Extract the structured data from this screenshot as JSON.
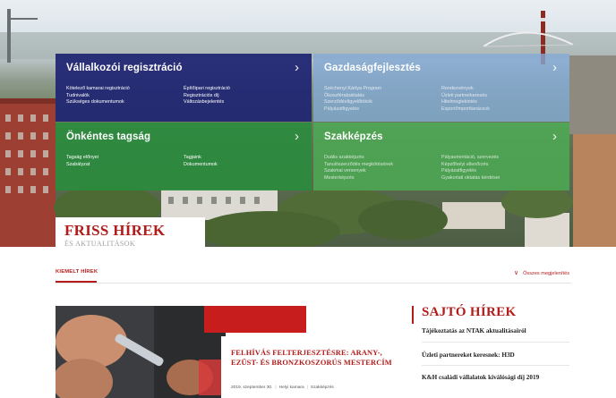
{
  "tiles": {
    "vallalkozoi": {
      "title": "Vállalkozói regisztráció",
      "col1": [
        "Kötelező kamarai regisztráció",
        "Tudnivalók",
        "Szükséges dokumentumok"
      ],
      "col2": [
        "Építőipari regisztráció",
        "Regisztrációs díj",
        "Változásbejelentés"
      ]
    },
    "gazdasag": {
      "title": "Gazdaságfejlesztés",
      "col1": [
        "Széchenyi Kártya Program",
        "Ökoszférabuktatás",
        "Szerződésfigyelőtökök",
        "Pályázatfigyelés"
      ],
      "col2": [
        "Rendezvények",
        "Üzleti partnerkeresés",
        "Hitelmegtekintés",
        "Export/Importtanácsok"
      ]
    },
    "onkentes": {
      "title": "Önkéntes tagság",
      "col1": [
        "Tagság előnyei",
        "Szabályzat"
      ],
      "col2": [
        "Tagjaink",
        "Dokumentumok"
      ]
    },
    "szakkepzes": {
      "title": "Szakképzés",
      "col1": [
        "Duális szakképzés",
        "Tanulószerződés megkötésének",
        "Szakmai versenyek",
        "Mesterképzés"
      ],
      "col2": [
        "Pályaorientáció, szervezés",
        "Képzőhelyi ellenőrzés",
        "Pályázatfigyelés",
        "Gyakorlati oktatás kérdései"
      ]
    }
  },
  "friss": {
    "title": "FRISS HÍREK",
    "subtitle": "ÉS AKTUALITÁSOK"
  },
  "newsbar": {
    "tab_label": "KIEMELT HÍREK",
    "all_label": "Összes megjelenítés"
  },
  "feature": {
    "title": "FELHÍVÁS FELTERJESZTÉSRE: ARANY-, EZÜST- ÉS BRONZKOSZORÚS MESTERCÍM",
    "date": "2019. szeptember 30.",
    "category": "Helyi kamara",
    "tag": "Szakképzés"
  },
  "sajto": {
    "title": "SAJTÓ HÍREK",
    "items": [
      "Tájékoztatás az NTAK aktualitásairól",
      "Üzleti partnereket keresnek: H3D",
      "K&H családi vállalatok kiválósági díj 2019"
    ]
  },
  "colors": {
    "brand_red": "#b31b1b",
    "tile_navy": "#1f2572",
    "tile_lightblue": "#83aad6",
    "tile_green": "#288c3c",
    "tile_lightgreen": "#4cac54"
  },
  "icons": {
    "tile_chevron": "chevron-right-icon",
    "all_news": "chevron-down-icon"
  }
}
